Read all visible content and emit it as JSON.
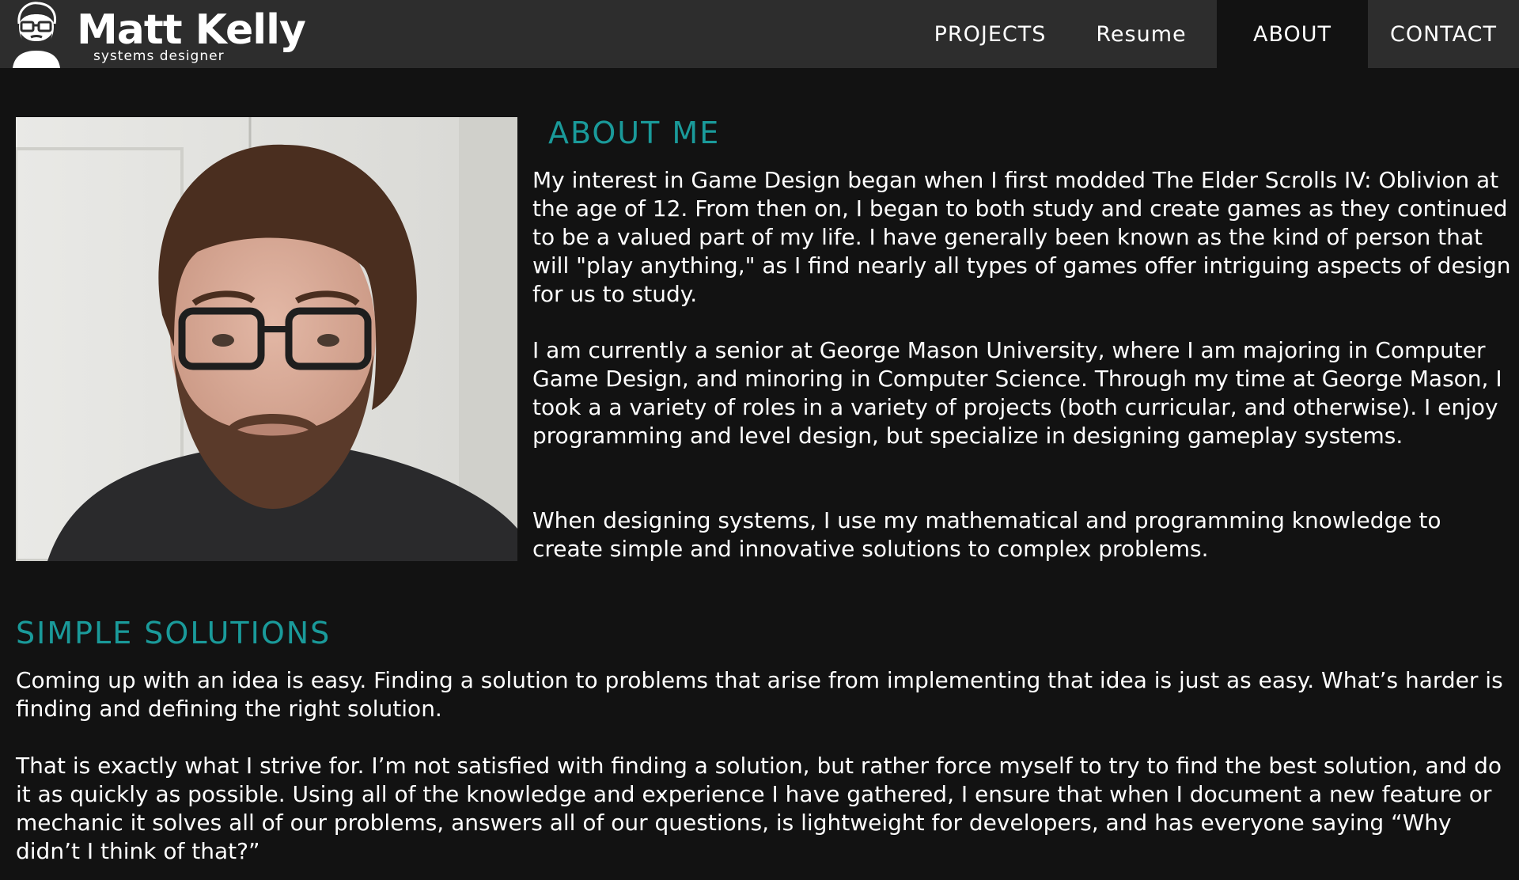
{
  "header": {
    "name": "Matt Kelly",
    "subtitle": "systems designer",
    "logo_icon": "cartoon-face-with-glasses-icon"
  },
  "nav": {
    "items": [
      {
        "label": "PROJECTS"
      },
      {
        "label": "Resume"
      },
      {
        "label": "ABOUT",
        "active": true
      },
      {
        "label": "CONTACT"
      }
    ]
  },
  "about": {
    "title": "ABOUT ME",
    "paragraphs": [
      "My interest in Game Design began when I first modded The Elder Scrolls IV: Oblivion at the age of 12. From then on, I began to both study and create games as they continued to be a valued part of my life. I have generally been known as the kind of person that will \"play anything,\" as I find nearly all types of games offer intriguing aspects of design for us to study.",
      "I am currently a senior at George Mason University, where I am majoring in Computer Game Design, and minoring in Computer Science. Through my time at George Mason, I took a a variety of roles in a variety of projects (both curricular, and otherwise). I enjoy programming and level design, but specialize in designing gameplay systems.",
      "When designing systems, I use my mathematical and programming knowledge to create simple and innovative solutions to complex problems."
    ]
  },
  "simple": {
    "title": "SIMPLE SOLUTIONS",
    "paragraphs": [
      "Coming up with an idea is easy. Finding a solution to problems that arise from implementing that idea is just as easy. What’s harder is finding and defining the right solution.",
      "That is exactly what I strive for. I’m not satisfied with finding a solution, but rather force myself to try to find the best solution, and do it as quickly as possible. Using all of the knowledge and experience I have gathered, I ensure that when I document a new feature or mechanic it solves all of our problems, answers all of our questions, is lightweight for developers, and has everyone saying “Why didn’t I think of that?”"
    ]
  },
  "colors": {
    "header_bg": "#2d2d2d",
    "page_bg": "#121212",
    "accent": "#1a9a9a",
    "text": "#ffffff"
  }
}
